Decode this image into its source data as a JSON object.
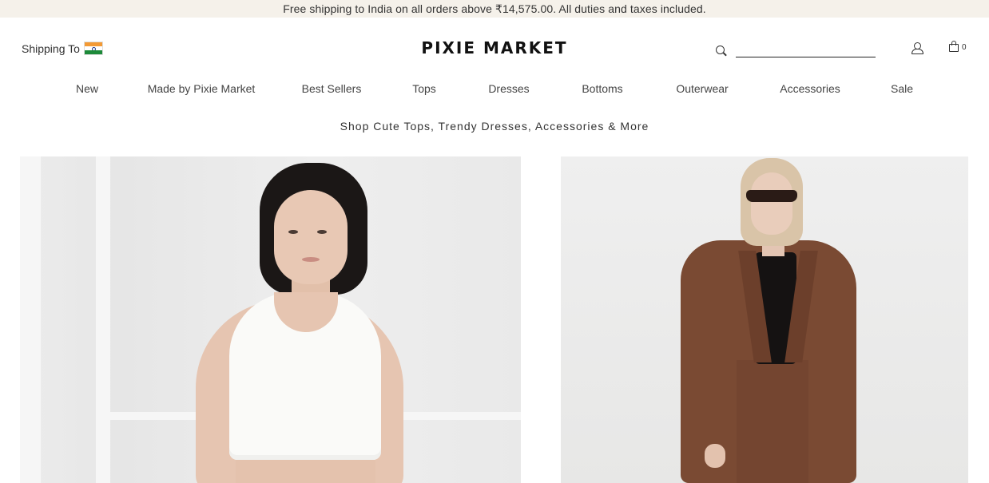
{
  "announcement": "Free shipping to India on all orders above ₹14,575.00. All duties and taxes included.",
  "header": {
    "shipping_label": "Shipping To",
    "flag_icon": "india-flag-icon",
    "logo": "PIXIE MARKET",
    "search_placeholder": "",
    "cart_count": "0"
  },
  "nav": {
    "items": [
      {
        "label": "New"
      },
      {
        "label": "Made by Pixie Market"
      },
      {
        "label": "Best Sellers"
      },
      {
        "label": "Tops"
      },
      {
        "label": "Dresses"
      },
      {
        "label": "Bottoms"
      },
      {
        "label": "Outerwear"
      },
      {
        "label": "Accessories"
      },
      {
        "label": "Sale"
      }
    ]
  },
  "tagline": "Shop Cute Tops, Trendy Dresses, Accessories & More",
  "colors": {
    "announce_bg": "#f5f1ea",
    "text": "#222222",
    "blazer": "#7a4a33"
  }
}
